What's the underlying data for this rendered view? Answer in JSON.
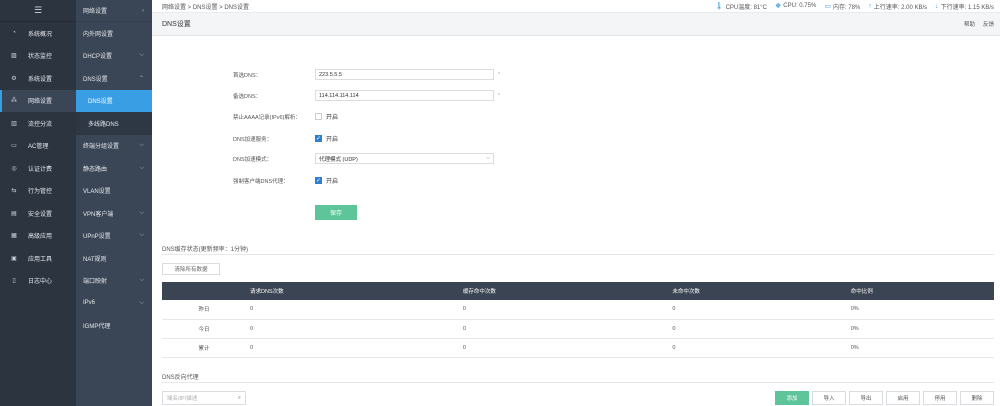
{
  "sidebar": {
    "items": [
      {
        "label": "系统概况",
        "icon": "dashboard-icon"
      },
      {
        "label": "状态监控",
        "icon": "monitor-chart-icon"
      },
      {
        "label": "系统设置",
        "icon": "gear-icon"
      },
      {
        "label": "网络设置",
        "icon": "network-icon"
      },
      {
        "label": "流控分流",
        "icon": "flow-control-icon"
      },
      {
        "label": "AC管理",
        "icon": "ac-manage-icon"
      },
      {
        "label": "认证计费",
        "icon": "auth-billing-icon"
      },
      {
        "label": "行为管控",
        "icon": "behavior-control-icon"
      },
      {
        "label": "安全设置",
        "icon": "security-icon"
      },
      {
        "label": "高级应用",
        "icon": "advanced-app-icon"
      },
      {
        "label": "应用工具",
        "icon": "app-tools-icon"
      },
      {
        "label": "日志中心",
        "icon": "log-icon"
      }
    ]
  },
  "subnav": {
    "header": "网络设置",
    "items": [
      "内外网设置",
      "DHCP设置",
      "DNS设置"
    ],
    "dns_children": [
      "DNS设置",
      "多线路DNS"
    ],
    "items_after": [
      "终端分组设置",
      "静态路由",
      "VLAN设置",
      "VPN客户端",
      "UPnP设置",
      "NAT规则",
      "端口映射",
      "IPv6",
      "IGMP代理"
    ]
  },
  "topbar": {
    "breadcrumb": "网络设置 > DNS设置 > DNS设置",
    "cpu_temp": "CPU温度: 81°C",
    "cpu": "CPU: 0.75%",
    "memory": "内存: 78%",
    "upload": "上行速率: 2.00 KB/s",
    "download": "下行速率: 1.15 KB/s"
  },
  "page": {
    "title": "DNS设置",
    "help": "帮助",
    "feedback": "反馈"
  },
  "form": {
    "primary_dns_label": "首选DNS：",
    "primary_dns_value": "223.5.5.5",
    "secondary_dns_label": "备选DNS：",
    "secondary_dns_value": "114.114.114.114",
    "required_mark": "*",
    "disable_aaaa_label": "禁止AAAA记录(IPv6)解析：",
    "disable_aaaa_text": "开启",
    "dns_accel_label": "DNS加速服务：",
    "dns_accel_text": "开启",
    "accel_mode_label": "DNS加速模式：",
    "accel_mode_value": "代理模式 (UDP)",
    "force_proxy_label": "强制客户端DNS代理：",
    "force_proxy_text": "开启",
    "save": "保存"
  },
  "cache": {
    "section_title": "DNS缓存状态(更新频率：1分钟)",
    "clear_button": "清除所有数据",
    "headers": [
      "",
      "请求DNS次数",
      "缓存命中次数",
      "未命中次数",
      "命中比例"
    ],
    "rows": [
      [
        "昨日",
        "0",
        "0",
        "0",
        "0%"
      ],
      [
        "今日",
        "0",
        "0",
        "0",
        "0%"
      ],
      [
        "累计",
        "0",
        "0",
        "0",
        "0%"
      ]
    ]
  },
  "reverse": {
    "section_title": "DNS反向代理",
    "search_placeholder": "域名/IP/描述",
    "buttons": [
      "添加",
      "导入",
      "导出",
      "启用",
      "停用",
      "删除"
    ]
  },
  "colors": {
    "nav_bg": "#2c3440",
    "subnav_bg": "#3a4556",
    "accent_blue": "#3a9ee5",
    "save_green": "#5ec49a",
    "table_header": "#3a4452"
  }
}
